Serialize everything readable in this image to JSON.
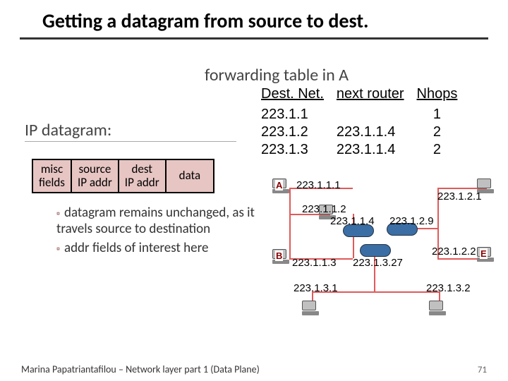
{
  "title": "Getting a datagram from source to dest.",
  "subtitle": "forwarding table in A",
  "table": {
    "h1": "Dest. Net.",
    "h2": "next router",
    "h3": "Nhops",
    "r1c1": "223.1.1",
    "r1c2": "",
    "r1c3": "1",
    "r2c1": "223.1.2",
    "r2c2": "223.1.1.4",
    "r2c3": "2",
    "r3c1": "223.1.3",
    "r3c2": "223.1.1.4",
    "r3c3": "2"
  },
  "ipdg_label": "IP datagram:",
  "dgram": {
    "c1a": "misc",
    "c1b": "fields",
    "c2a": "source",
    "c2b": "IP addr",
    "c3a": "dest",
    "c3b": "IP addr",
    "c4": "data"
  },
  "bullet1": "datagram remains unchanged, as it travels source to destination",
  "bullet2": "addr fields of interest here",
  "labels": {
    "A": "A",
    "B": "B",
    "E": "E"
  },
  "ips": {
    "a": "223.1.1.1",
    "b": "223.1.1.2",
    "c": "223.1.1.3",
    "d": "223.1.1.4",
    "e": "223.1.2.1",
    "f": "223.1.2.9",
    "g": "223.1.2.2",
    "h": "223.1.3.27",
    "i": "223.1.3.1",
    "j": "223.1.3.2"
  },
  "footer": "Marina Papatriantafilou – Network layer part 1 (Data Plane)",
  "pagenum": "71"
}
